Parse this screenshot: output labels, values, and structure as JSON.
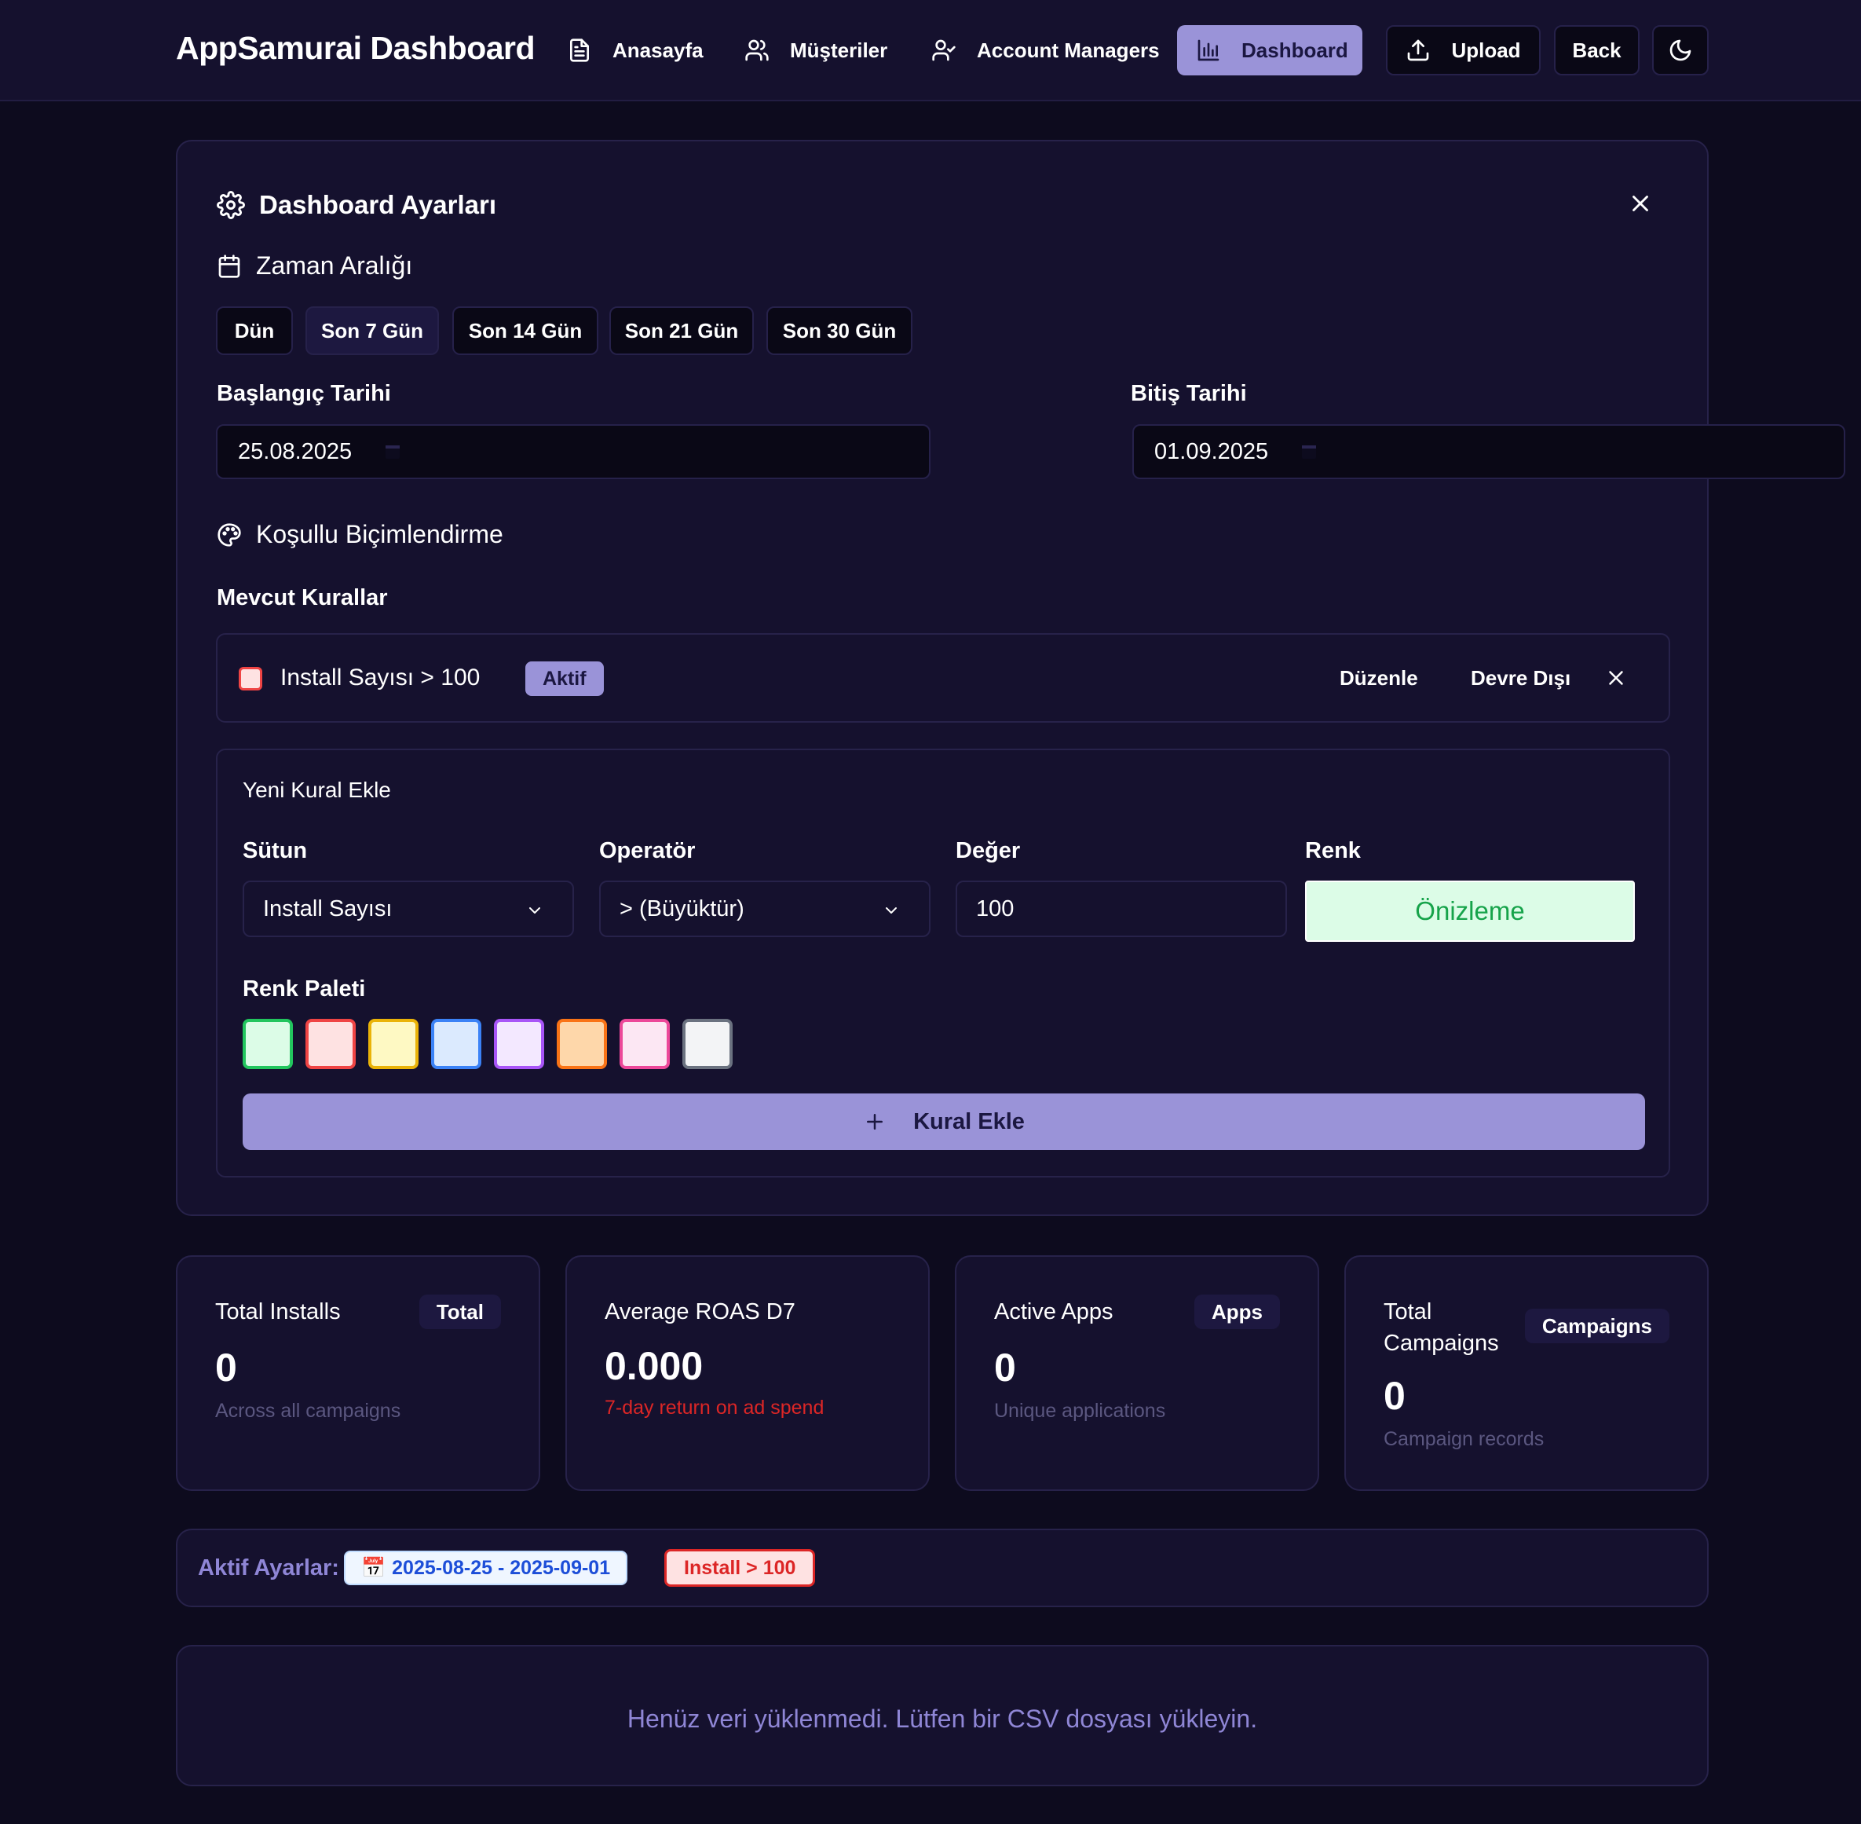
{
  "nav": {
    "brand": "AppSamurai Dashboard",
    "links": [
      {
        "label": "Anasayfa",
        "icon": "file-text-icon"
      },
      {
        "label": "Müşteriler",
        "icon": "users-icon"
      },
      {
        "label": "Account Managers",
        "icon": "user-check-icon"
      },
      {
        "label": "Dashboard",
        "icon": "bar-chart-icon",
        "active": true
      }
    ],
    "upload_label": "Upload",
    "back_label": "Back",
    "theme_icon": "moon-icon"
  },
  "settings": {
    "title": "Dashboard Ayarları",
    "time_range": {
      "title": "Zaman Aralığı",
      "presets": [
        "Dün",
        "Son 7 Gün",
        "Son 14 Gün",
        "Son 21 Gün",
        "Son 30 Gün"
      ],
      "selected": "Son 7 Gün",
      "start_label": "Başlangıç Tarihi",
      "start_value": "25.08.2025",
      "end_label": "Bitiş Tarihi",
      "end_value": "01.09.2025"
    },
    "conditional": {
      "title": "Koşullu Biçimlendirme",
      "existing_label": "Mevcut Kurallar",
      "rules": [
        {
          "text": "Install Sayısı > 100",
          "status": "Aktif",
          "edit_label": "Düzenle",
          "disable_label": "Devre Dışı",
          "color": "#fee2e2"
        }
      ],
      "new_rule": {
        "title": "Yeni Kural Ekle",
        "column_label": "Sütun",
        "column_value": "Install Sayısı",
        "operator_label": "Operatör",
        "operator_value": "> (Büyüktür)",
        "value_label": "Değer",
        "value_value": "100",
        "color_label": "Renk",
        "preview_label": "Önizleme",
        "palette_label": "Renk Paleti",
        "palette": [
          {
            "fill": "#dcfce7",
            "border": "#22c55e"
          },
          {
            "fill": "#fee2e2",
            "border": "#ef4444"
          },
          {
            "fill": "#fef9c3",
            "border": "#eab308"
          },
          {
            "fill": "#dbeafe",
            "border": "#3b82f6"
          },
          {
            "fill": "#f3e8ff",
            "border": "#a855f7"
          },
          {
            "fill": "#fed7aa",
            "border": "#f97316"
          },
          {
            "fill": "#fce7f3",
            "border": "#ec4899"
          },
          {
            "fill": "#f3f4f6",
            "border": "#6b7280"
          }
        ],
        "add_label": "Kural Ekle"
      }
    }
  },
  "stats": [
    {
      "title": "Total Installs",
      "badge": "Total",
      "value": "0",
      "sub": "Across all campaigns"
    },
    {
      "title": "Average ROAS D7",
      "badge": "",
      "value": "0.000",
      "sub": "7-day return on ad spend"
    },
    {
      "title": "Active Apps",
      "badge": "Apps",
      "value": "0",
      "sub": "Unique applications"
    },
    {
      "title": "Total Campaigns",
      "badge": "Campaigns",
      "value": "0",
      "sub": "Campaign records"
    }
  ],
  "active_settings": {
    "label": "Aktif Ayarlar:",
    "date_emoji": "📅",
    "date_range": "2025-08-25 - 2025-09-01",
    "rule_chip": "Install > 100"
  },
  "empty_message": "Henüz veri yüklenmedi. Lütfen bir CSV dosyası yükleyin.",
  "colors": {
    "background": "#0d0b1e",
    "card": "#15112e",
    "accent": "#9a93d8",
    "accent_text": "#8f86d6",
    "danger": "#dc2626",
    "success": "#16a34a"
  }
}
